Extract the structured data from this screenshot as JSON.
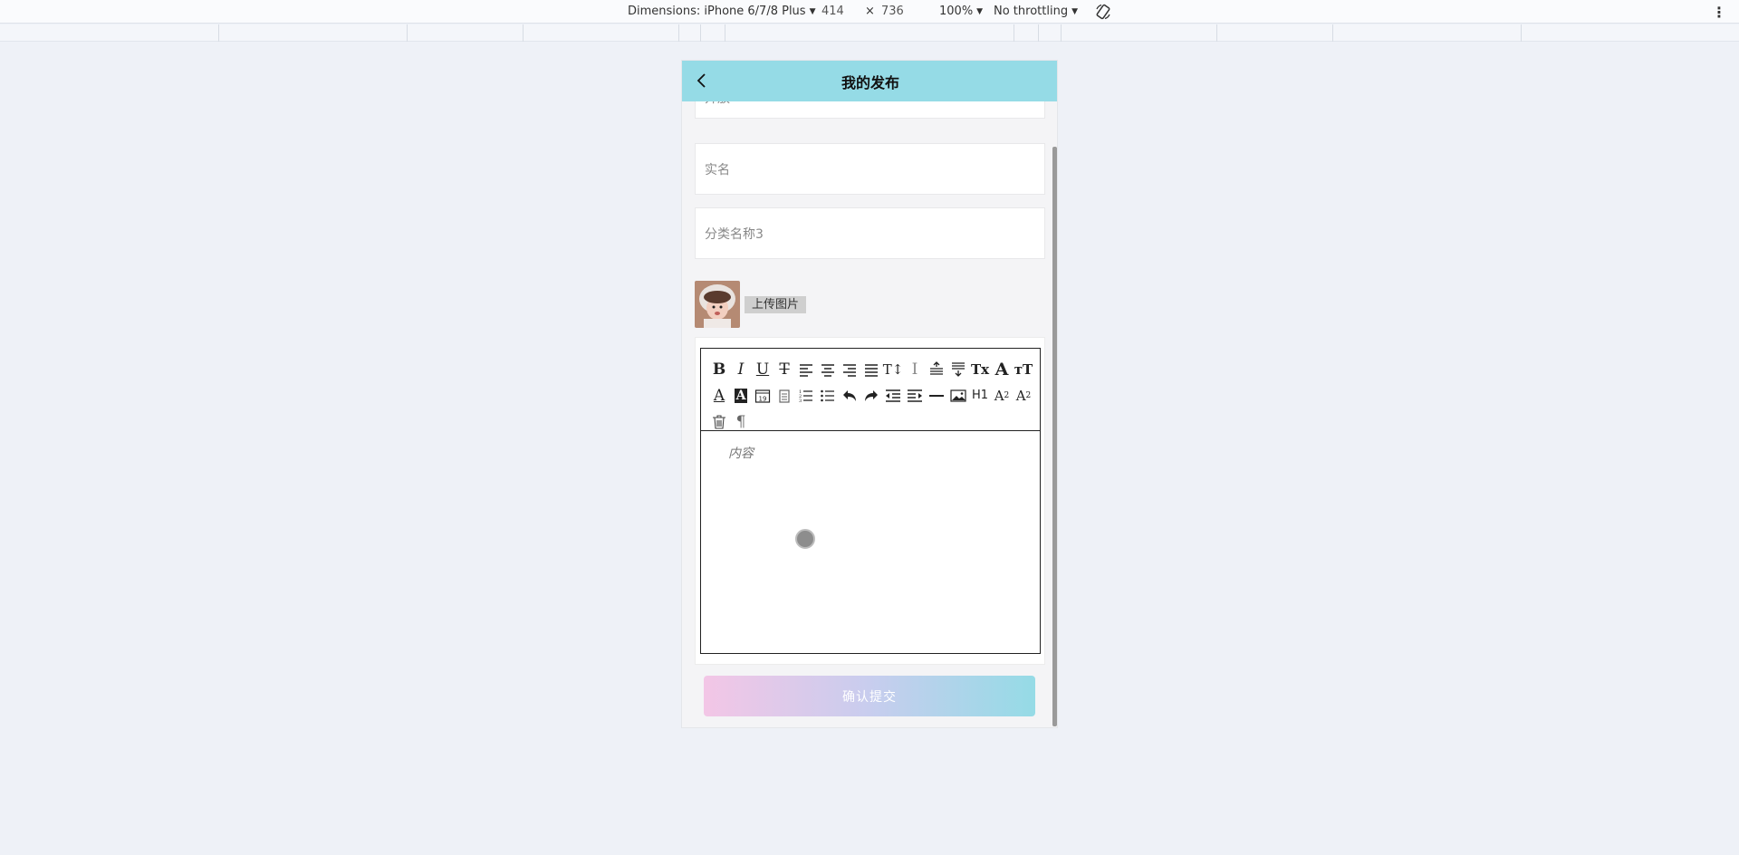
{
  "devtools": {
    "dimensions_label": "Dimensions: iPhone 6/7/8 Plus",
    "width": "414",
    "times": "×",
    "height": "736",
    "zoom": "100%",
    "throttling": "No throttling"
  },
  "page": {
    "title": "我的发布",
    "fields": [
      {
        "placeholder": "开放"
      },
      {
        "placeholder": "实名"
      },
      {
        "placeholder": "分类名称3"
      }
    ],
    "upload_label": "上传图片",
    "editor": {
      "placeholder": "内容",
      "toolbar_row1": [
        "B",
        "I",
        "U",
        "S",
        "≡",
        "≡",
        "≡",
        "≡",
        "T↕",
        "I",
        "≡",
        "≡",
        "Tx",
        "A",
        "Tr"
      ],
      "toolbar_row2": [
        "A",
        "A",
        "19",
        "▤",
        "⒈",
        "•",
        "↶",
        "↷",
        "⇤",
        "⇥",
        "—",
        "▣",
        "H1",
        "A₂",
        "A²"
      ],
      "toolbar_row3": [
        "🗑",
        "¶"
      ]
    },
    "submit_label": "确认提交"
  },
  "colors": {
    "navbar": "#95dbe6",
    "gradient_start": "#f3c6e6",
    "gradient_end": "#95dbe6",
    "page_bg": "#eef1f7"
  }
}
